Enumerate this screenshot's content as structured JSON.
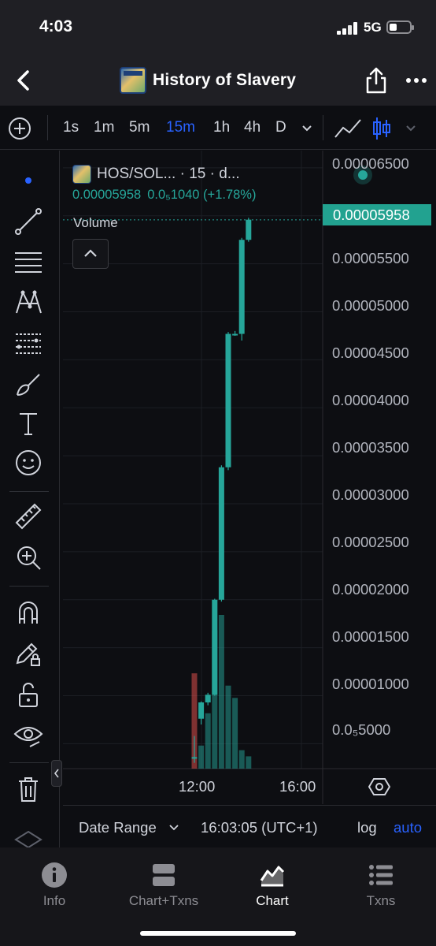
{
  "status_bar": {
    "time": "4:03",
    "network": "5G"
  },
  "header": {
    "title": "History of Slavery"
  },
  "timeframes": {
    "items": [
      "1s",
      "1m",
      "5m",
      "15m",
      "1h",
      "4h",
      "D"
    ],
    "active": "15m"
  },
  "legend": {
    "symbol": "HOS/SOL... · 15 · d...",
    "price": "0.00005958",
    "change": "0.0₅1040 (+1.78%)",
    "volume_label": "Volume"
  },
  "price_tag": "0.00005958",
  "colors": {
    "up": "#26a69a",
    "down": "#ef5350",
    "accent": "#2962ff",
    "price_tag": "#22a290"
  },
  "chart_data": {
    "type": "candlestick",
    "y_axis": {
      "ticks": [
        "0.00006500",
        "0.00006000",
        "0.00005500",
        "0.00005000",
        "0.00004500",
        "0.00004000",
        "0.00003500",
        "0.00003000",
        "0.00002500",
        "0.00002000",
        "0.00001500",
        "0.00001000",
        "0.0₅5000"
      ],
      "range": [
        2.4e-06,
        6.68e-05
      ]
    },
    "x_axis": {
      "ticks": [
        "12:00",
        "16:00"
      ]
    },
    "last_price": 5.958e-05,
    "candles": [
      {
        "o": 3.6e-06,
        "h": 5.8e-06,
        "l": 3e-06,
        "c": 3.6e-06
      },
      {
        "o": 7.6e-06,
        "h": 9.4e-06,
        "l": 7e-06,
        "c": 9.3e-06
      },
      {
        "o": 9.3e-06,
        "h": 1.03e-05,
        "l": 9e-06,
        "c": 1.01e-05
      },
      {
        "o": 1.01e-05,
        "h": 2.01e-05,
        "l": 1e-05,
        "c": 2e-05
      },
      {
        "o": 2e-05,
        "h": 3.4e-05,
        "l": 1.98e-05,
        "c": 3.38e-05
      },
      {
        "o": 3.38e-05,
        "h": 4.79e-05,
        "l": 3.35e-05,
        "c": 4.77e-05
      },
      {
        "o": 4.77e-05,
        "h": 4.8e-05,
        "l": 4.75e-05,
        "c": 4.77e-05
      },
      {
        "o": 4.77e-05,
        "h": 5.77e-05,
        "l": 4.7e-05,
        "c": 5.75e-05
      },
      {
        "o": 5.75e-05,
        "h": 5.98e-05,
        "l": 5.73e-05,
        "c": 5.96e-05
      }
    ],
    "volume": [
      {
        "v": 0.62,
        "dir": "down"
      },
      {
        "v": 0.15,
        "dir": "up"
      },
      {
        "v": 0.36,
        "dir": "up"
      },
      {
        "v": 0.9,
        "dir": "up"
      },
      {
        "v": 1.0,
        "dir": "up"
      },
      {
        "v": 0.54,
        "dir": "up"
      },
      {
        "v": 0.46,
        "dir": "up"
      },
      {
        "v": 0.12,
        "dir": "up"
      },
      {
        "v": 0.08,
        "dir": "up"
      }
    ]
  },
  "bottom_controls": {
    "date_range": "Date Range",
    "timezone": "16:03:05 (UTC+1)",
    "log": "log",
    "auto": "auto"
  },
  "tabs": [
    {
      "label": "Info",
      "icon": "info-icon"
    },
    {
      "label": "Chart+Txns",
      "icon": "split-icon"
    },
    {
      "label": "Chart",
      "icon": "chart-icon",
      "active": true
    },
    {
      "label": "Txns",
      "icon": "list-icon"
    }
  ]
}
